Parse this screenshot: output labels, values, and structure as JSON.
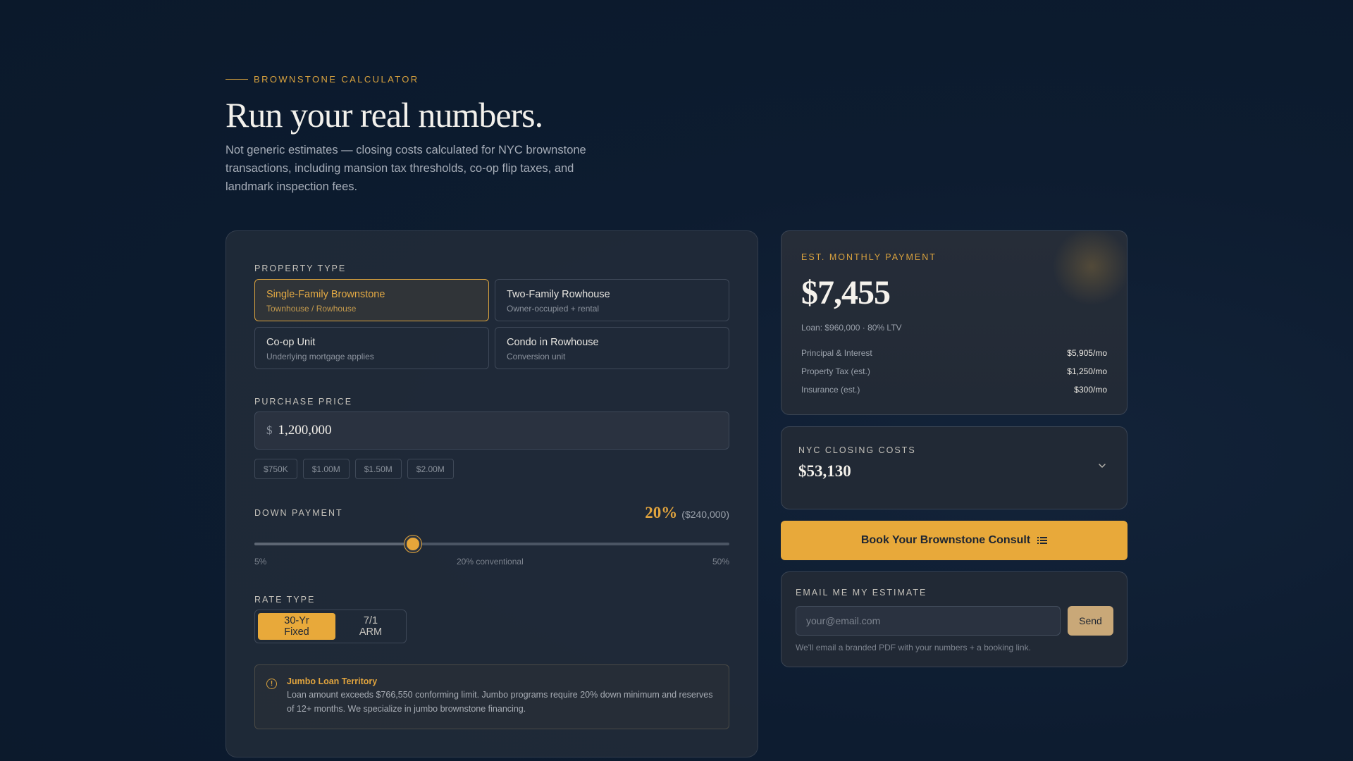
{
  "header": {
    "eyebrow": "BROWNSTONE CALCULATOR",
    "title": "Run your real numbers.",
    "subtitle": "Not generic estimates — closing costs calculated for NYC brownstone transactions, including mansion tax thresholds, co-op flip taxes, and landmark inspection fees."
  },
  "calculator": {
    "property_type": {
      "label": "PROPERTY TYPE",
      "options": [
        {
          "title": "Single-Family Brownstone",
          "sub": "Townhouse / Rowhouse",
          "selected": true
        },
        {
          "title": "Two-Family Rowhouse",
          "sub": "Owner-occupied + rental",
          "selected": false
        },
        {
          "title": "Co-op Unit",
          "sub": "Underlying mortgage applies",
          "selected": false
        },
        {
          "title": "Condo in Rowhouse",
          "sub": "Conversion unit",
          "selected": false
        }
      ]
    },
    "purchase_price": {
      "label": "PURCHASE PRICE",
      "currency": "$",
      "value": "1,200,000",
      "presets": [
        "$750K",
        "$1.00M",
        "$1.50M",
        "$2.00M"
      ]
    },
    "down_payment": {
      "label": "DOWN PAYMENT",
      "percent_text": "20%",
      "amount_text": "($240,000)",
      "percent": 20,
      "min": 5,
      "max": 50,
      "min_label": "5%",
      "mid_label": "20% conventional",
      "max_label": "50%"
    },
    "rate_type": {
      "label": "RATE TYPE",
      "options": [
        "30-Yr Fixed",
        "7/1 ARM"
      ],
      "selected": "30-Yr Fixed"
    },
    "notice": {
      "icon": "info-circle-icon",
      "title": "Jumbo Loan Territory",
      "body": "Loan amount exceeds $766,550 conforming limit. Jumbo programs require 20% down minimum and reserves of 12+ months. We specialize in jumbo brownstone financing."
    }
  },
  "monthly": {
    "label": "EST. MONTHLY PAYMENT",
    "amount": "$7,455",
    "loan": "Loan: $960,000 · 80% LTV",
    "rows": [
      {
        "k": "Principal & Interest",
        "v": "$5,905/mo"
      },
      {
        "k": "Property Tax (est.)",
        "v": "$1,250/mo"
      },
      {
        "k": "Insurance (est.)",
        "v": "$300/mo"
      }
    ]
  },
  "closing": {
    "label": "NYC CLOSING COSTS",
    "amount": "$53,130",
    "icon": "chevron-down-icon"
  },
  "cta": {
    "label": "Book Your Brownstone Consult",
    "icon": "list-icon"
  },
  "email": {
    "label": "EMAIL ME MY ESTIMATE",
    "placeholder": "your@email.com",
    "button": "Send",
    "note": "We'll email a branded PDF with your numbers + a booking link."
  },
  "colors": {
    "accent": "#e8a93a",
    "background": "#0d1c30",
    "card": "#212935"
  }
}
